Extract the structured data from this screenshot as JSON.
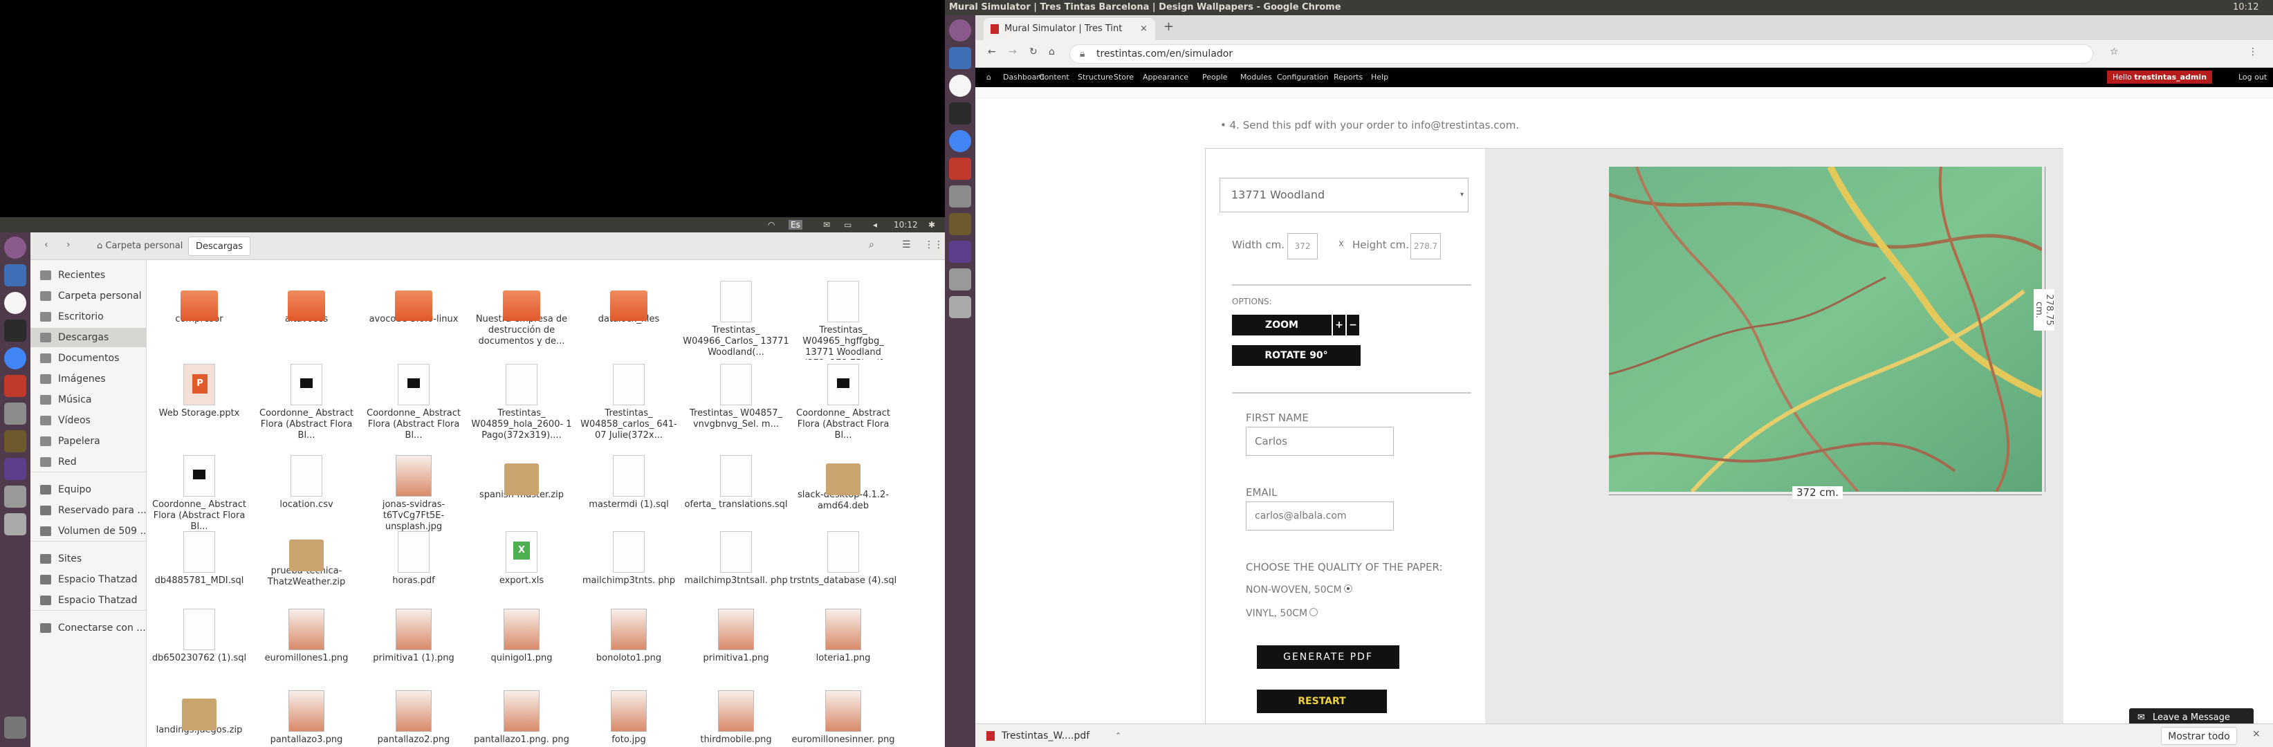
{
  "left_topbar": {
    "time": "10:12",
    "lang": "Es"
  },
  "files": {
    "path_home": "Carpeta personal",
    "path_current": "Descargas",
    "sidebar": [
      {
        "label": "Recientes",
        "icon": "clock-icon"
      },
      {
        "label": "Carpeta personal",
        "icon": "home-icon"
      },
      {
        "label": "Escritorio",
        "icon": "desktop-icon"
      },
      {
        "label": "Descargas",
        "icon": "download-icon"
      },
      {
        "label": "Documentos",
        "icon": "document-icon"
      },
      {
        "label": "Imágenes",
        "icon": "image-icon"
      },
      {
        "label": "Música",
        "icon": "music-icon"
      },
      {
        "label": "Vídeos",
        "icon": "video-icon"
      },
      {
        "label": "Papelera",
        "icon": "trash-icon"
      },
      {
        "label": "Red",
        "icon": "network-icon"
      },
      {
        "label": "Equipo",
        "icon": "computer-icon"
      },
      {
        "label": "Reservado para ...",
        "icon": "drive-icon"
      },
      {
        "label": "Volumen de 509 ...",
        "icon": "drive-icon"
      },
      {
        "label": "Sites",
        "icon": "folder-icon"
      },
      {
        "label": "Espacio Thatzad",
        "icon": "folder-icon"
      },
      {
        "label": "Espacio Thatzad",
        "icon": "folder-icon"
      },
      {
        "label": "Conectarse con ...",
        "icon": "server-icon"
      }
    ],
    "items": [
      {
        "name": "compresor",
        "type": "folder"
      },
      {
        "name": "altavoces",
        "type": "folder"
      },
      {
        "name": "avocode-3.0.0-linux",
        "type": "folder"
      },
      {
        "name": "Nuestra empresa de destrucción de documentos y de...",
        "type": "folder"
      },
      {
        "name": "datalock_files",
        "type": "folder"
      },
      {
        "name": "Trestintas_ W04966_Carlos_ 13771 Woodland(...",
        "type": "doc"
      },
      {
        "name": "Trestintas_ W04965_hgffgbg_ 13771 Woodland (372x278.75).pdf",
        "type": "doc"
      },
      {
        "name": "Web Storage.pptx",
        "type": "pptx"
      },
      {
        "name": "Coordonne_ Abstract Flora (Abstract Flora Bl...",
        "type": "pdfblk"
      },
      {
        "name": "Coordonne_ Abstract Flora (Abstract Flora Bl...",
        "type": "pdfblk"
      },
      {
        "name": "Trestintas_ W04859_hola_2600- 1 Pago(372x319)....",
        "type": "doc"
      },
      {
        "name": "Trestintas_ W04858_carlos_ 641-07 Julie(372x...",
        "type": "doc"
      },
      {
        "name": "Trestintas_ W04857_ vnvgbnvg_Sel. m...",
        "type": "doc"
      },
      {
        "name": "Coordonne_ Abstract Flora (Abstract Flora Bl...",
        "type": "pdfblk"
      },
      {
        "name": "Coordonne_ Abstract Flora (Abstract Flora Bl...",
        "type": "pdfblk"
      },
      {
        "name": "location.csv",
        "type": "doc"
      },
      {
        "name": "jonas-svidras- t6TvCg7Ft5E- unsplash.jpg",
        "type": "img"
      },
      {
        "name": "spanish-master.zip",
        "type": "zip"
      },
      {
        "name": "mastermdi (1).sql",
        "type": "doc"
      },
      {
        "name": "oferta_ translations.sql",
        "type": "doc"
      },
      {
        "name": "slack-desktop-4.1.2- amd64.deb",
        "type": "zip"
      },
      {
        "name": "db4885781_MDI.sql",
        "type": "doc"
      },
      {
        "name": "prueba-tecnica- ThatzWeather.zip",
        "type": "zip"
      },
      {
        "name": "horas.pdf",
        "type": "doc"
      },
      {
        "name": "export.xls",
        "type": "xls"
      },
      {
        "name": "mailchimp3tnts. php",
        "type": "doc"
      },
      {
        "name": "mailchimp3tntsall. php",
        "type": "doc"
      },
      {
        "name": "trstnts_database (4).sql",
        "type": "doc"
      },
      {
        "name": "db650230762 (1).sql",
        "type": "doc"
      },
      {
        "name": "euromillones1.png",
        "type": "img"
      },
      {
        "name": "primitiva1 (1).png",
        "type": "img"
      },
      {
        "name": "quinigol1.png",
        "type": "img"
      },
      {
        "name": "bonoloto1.png",
        "type": "img"
      },
      {
        "name": "primitiva1.png",
        "type": "img"
      },
      {
        "name": "loteria1.png",
        "type": "img"
      },
      {
        "name": "landings.juegos.zip",
        "type": "zip"
      },
      {
        "name": "pantallazo3.png",
        "type": "img"
      },
      {
        "name": "pantallazo2.png",
        "type": "img"
      },
      {
        "name": "pantallazo1.png. png",
        "type": "img"
      },
      {
        "name": "foto.jpg",
        "type": "img"
      },
      {
        "name": "thirdmobile.png",
        "type": "img"
      },
      {
        "name": "euromillonesinner. png",
        "type": "img"
      }
    ]
  },
  "right_topbar": {
    "title": "Mural Simulator | Tres Tintas Barcelona | Design Wallpapers - Google Chrome",
    "time": "10:12"
  },
  "chrome": {
    "tab_title": "Mural Simulator | Tres Tint",
    "url": "trestintas.com/en/simulador",
    "admin_menu": [
      "Dashboard",
      "Content",
      "Structure",
      "Store",
      "Appearance",
      "People",
      "Modules",
      "Configuration",
      "Reports",
      "Help"
    ],
    "admin_hello": "Hello",
    "admin_user": "trestintas_admin",
    "admin_logout": "Log out"
  },
  "page": {
    "instruction": "4. Send this pdf with your order to info@trestintas.com.",
    "design_select": "13771 Woodland",
    "width_label": "Width cm.",
    "width_value": "372",
    "x_sep": "x",
    "height_label": "Height cm.",
    "height_value": "278.7",
    "options_label": "OPTIONS:",
    "zoom_label": "ZOOM",
    "zoom_plus": "+",
    "zoom_minus": "−",
    "rotate_label": "ROTATE 90°",
    "first_name_label": "FIRST NAME",
    "first_name_value": "Carlos",
    "email_label": "EMAIL",
    "email_value": "carlos@albala.com",
    "quality_label": "CHOOSE THE QUALITY OF THE PAPER:",
    "quality_options": [
      "NON-WOVEN, 50CM",
      "VINYL, 50CM"
    ],
    "generate_pdf": "GENERATE PDF",
    "restart": "RESTART",
    "dim_width": "372 cm.",
    "dim_height": "278.75 cm.",
    "leave_message": "Leave a Message",
    "restart_color": "#f0d23c"
  },
  "download": {
    "file": "Trestintas_W....pdf",
    "show_all": "Mostrar todo"
  }
}
